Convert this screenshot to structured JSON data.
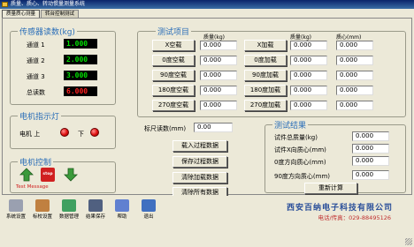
{
  "window": {
    "title": "质量、质心、转动惯量测量系统"
  },
  "tabs": [
    "质量质心测量",
    "转台控制测试"
  ],
  "sensor": {
    "title": "传感器读数(kg)",
    "channels": [
      {
        "label": "通道 1",
        "value": "1.000"
      },
      {
        "label": "通道 2",
        "value": "2.000"
      },
      {
        "label": "通道 3",
        "value": "3.000"
      },
      {
        "label": "总读数",
        "value": "6.000"
      }
    ]
  },
  "motor_indicator": {
    "title": "电机指示灯",
    "label": "电机 上",
    "down": "下"
  },
  "motor_control": {
    "title": "电机控制",
    "message": "Test Message",
    "stop": "stop"
  },
  "test_items": {
    "title": "测试项目",
    "headers": {
      "mass_left": "质量(kg)",
      "mass_right": "质量(kg)",
      "centroid": "质心(mm)"
    },
    "rows": [
      {
        "left": "X空载",
        "lval": "0.000",
        "right": "X加载",
        "rval": "0.000",
        "cval": "0.000"
      },
      {
        "left": "0度空载",
        "lval": "0.000",
        "right": "0度加载",
        "rval": "0.000",
        "cval": "0.000"
      },
      {
        "left": "90度空载",
        "lval": "0.000",
        "right": "90度加载",
        "rval": "0.000",
        "cval": "0.000"
      },
      {
        "left": "180度空载",
        "lval": "0.000",
        "right": "180度加载",
        "rval": "0.000",
        "cval": "0.000"
      },
      {
        "left": "270度空载",
        "lval": "0.000",
        "right": "270度加载",
        "rval": "0.000",
        "cval": "0.000"
      }
    ]
  },
  "ruler": {
    "label": "标尺读数(mm)",
    "value": "0.00"
  },
  "actions": {
    "load": "载入过程数据",
    "save": "保存过程数据",
    "clear_load": "清除加载数据",
    "clear_all": "清除所有数据"
  },
  "results": {
    "title": "测试结果",
    "rows": [
      {
        "label": "试件总质量(kg)",
        "value": "0.000"
      },
      {
        "label": "试件X向质心(mm)",
        "value": "0.000"
      },
      {
        "label": "0度方向质心(mm)",
        "value": "0.000"
      },
      {
        "label": "90度方向质心(mm)",
        "value": "0.000"
      }
    ],
    "recalc": "重新计算"
  },
  "toolbar": [
    {
      "label": "系统设置",
      "icon": "settings-icon",
      "color": "#9aa0b0"
    },
    {
      "label": "标校设置",
      "icon": "calibrate-icon",
      "color": "#c08040"
    },
    {
      "label": "数据管理",
      "icon": "data-icon",
      "color": "#40a060"
    },
    {
      "label": "结果保存",
      "icon": "save-icon",
      "color": "#506080"
    },
    {
      "label": "帮助",
      "icon": "help-icon",
      "color": "#6080d0"
    },
    {
      "label": "退出",
      "icon": "exit-icon",
      "color": "#4070c0"
    }
  ],
  "footer": {
    "company": "西安百纳电子科技有限公司",
    "phone": "电话/传真：029-88495126"
  }
}
